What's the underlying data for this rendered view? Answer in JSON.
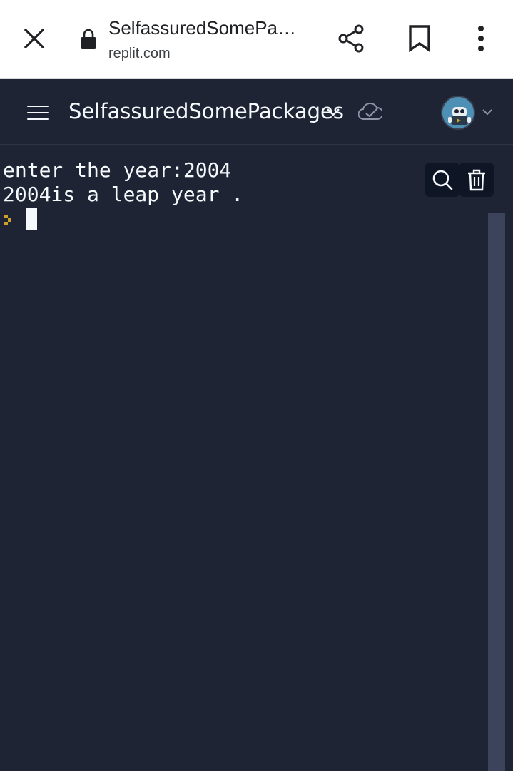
{
  "browser": {
    "page_title": "SelfassuredSomePackages",
    "url": "replit.com",
    "icons": [
      "close-icon",
      "lock-icon",
      "share-icon",
      "bookmark-icon",
      "more-vert-icon"
    ]
  },
  "header": {
    "repl_name": "SelfassuredSomePackages",
    "icons": [
      "hamburger-menu-icon",
      "chevron-down-icon",
      "cloud-saved-icon",
      "avatar",
      "chevron-down-icon"
    ]
  },
  "console": {
    "lines": [
      "enter the year:2004",
      "2004is a leap year ."
    ],
    "icons": [
      "prompt-icon",
      "search-icon",
      "trash-icon"
    ]
  },
  "colors": {
    "background": "#1f2434",
    "text": "#f5f9fc",
    "button_bg": "#0e1525",
    "scrollbar": "#3c445c",
    "prompt_accent": "#c9a227",
    "avatar_bg": "#4d8fb5"
  }
}
